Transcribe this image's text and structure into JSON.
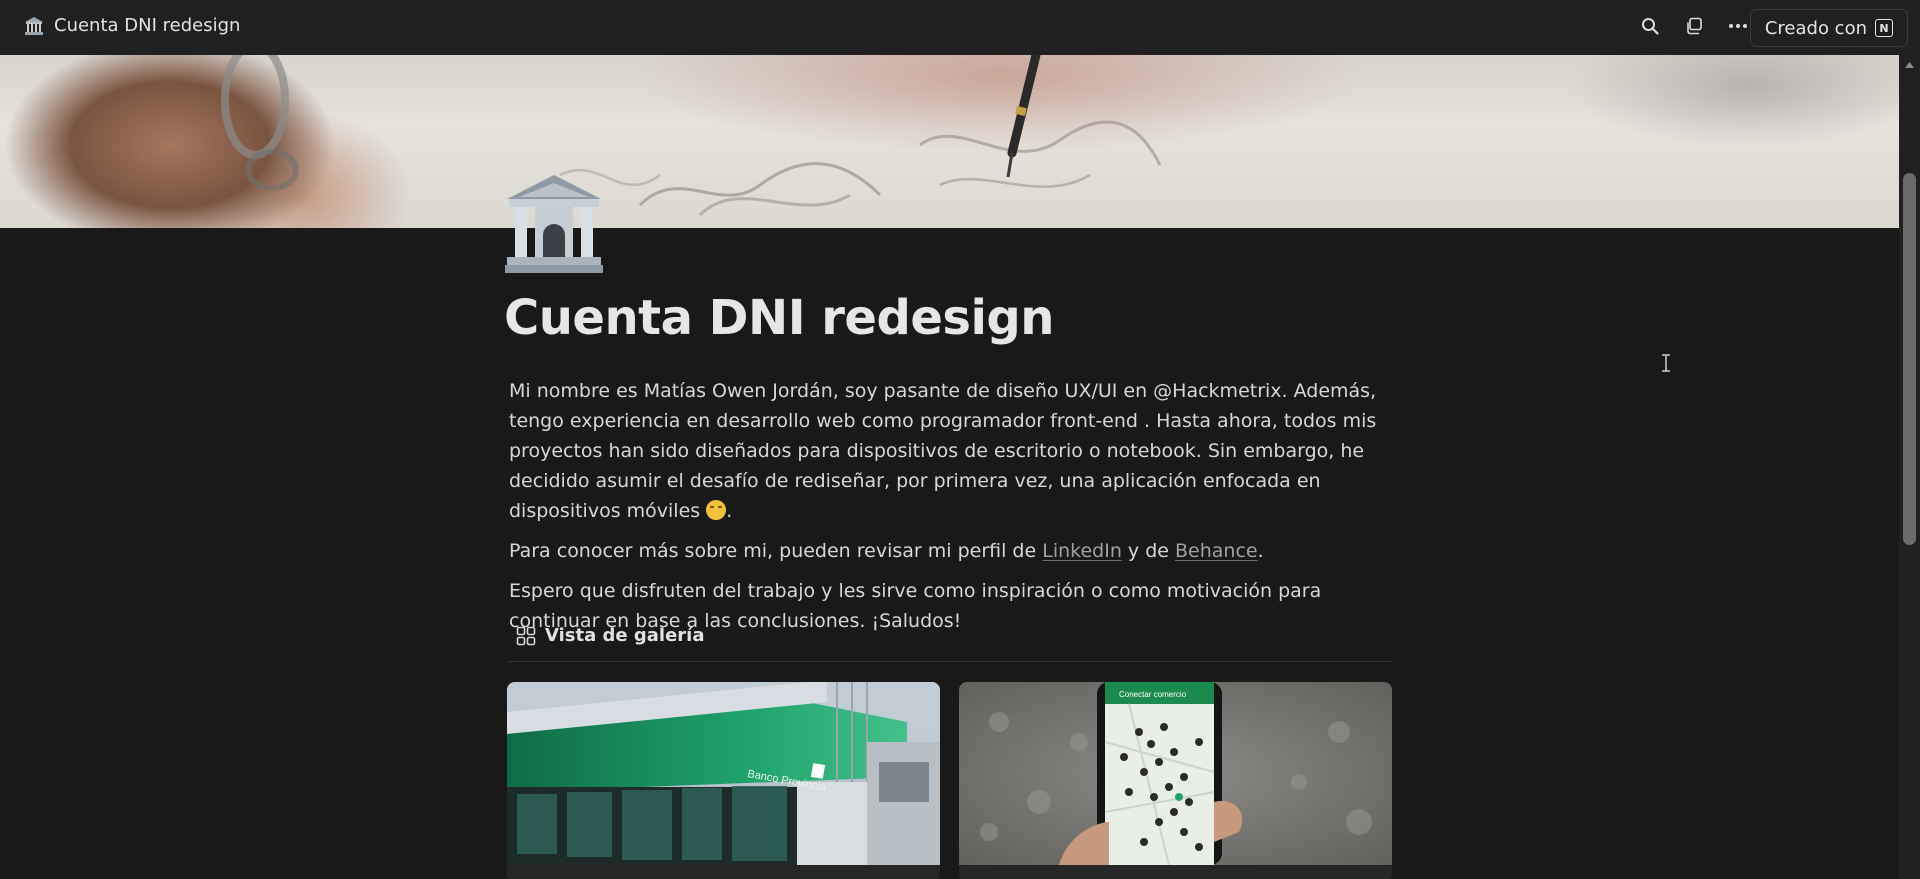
{
  "topbar": {
    "page_title": "Cuenta DNI redesign",
    "page_icon": "bank-building-icon",
    "icons": [
      "search-icon",
      "duplicate-icon",
      "more-icon"
    ],
    "made_with_label": "Creado con",
    "made_with_logo": "notion-logo"
  },
  "page": {
    "title": "Cuenta DNI redesign",
    "icon": "bank-building-icon",
    "paragraph1": "Mi nombre es Matías Owen Jordán, soy pasante de diseño UX/UI en @Hackmetrix. Además, tengo experiencia en desarrollo web como programador front-end . Hasta ahora, todos mis proyectos han sido diseñados para dispositivos de escritorio o notebook. Sin embargo, he decidido asumir el desafío de rediseñar, por primera vez, una aplicación enfocada en dispositivos móviles",
    "paragraph1_end": ".",
    "paragraph2_start": "Para conocer más sobre mi, pueden revisar mi perfil de",
    "linkedin_label": "LinkedIn",
    "paragraph2_mid": "y de",
    "behance_label": "Behance",
    "paragraph2_end": ".",
    "paragraph3": "Espero que disfruten del trabajo y les sirve como inspiración o como motivación para continuar en base a las conclusiones. ¡Saludos!"
  },
  "gallery": {
    "view_label": "Vista de galería",
    "view_icon": "gallery-grid-icon",
    "cards": [
      {
        "image": "bank-branch-photo",
        "sign_text": "Banco Provincia"
      },
      {
        "image": "phone-map-photo",
        "screen_header": "Conectar comercio"
      }
    ]
  },
  "colors": {
    "background": "#191919",
    "topbar": "#202020",
    "accent_green": "#1fa36b"
  }
}
